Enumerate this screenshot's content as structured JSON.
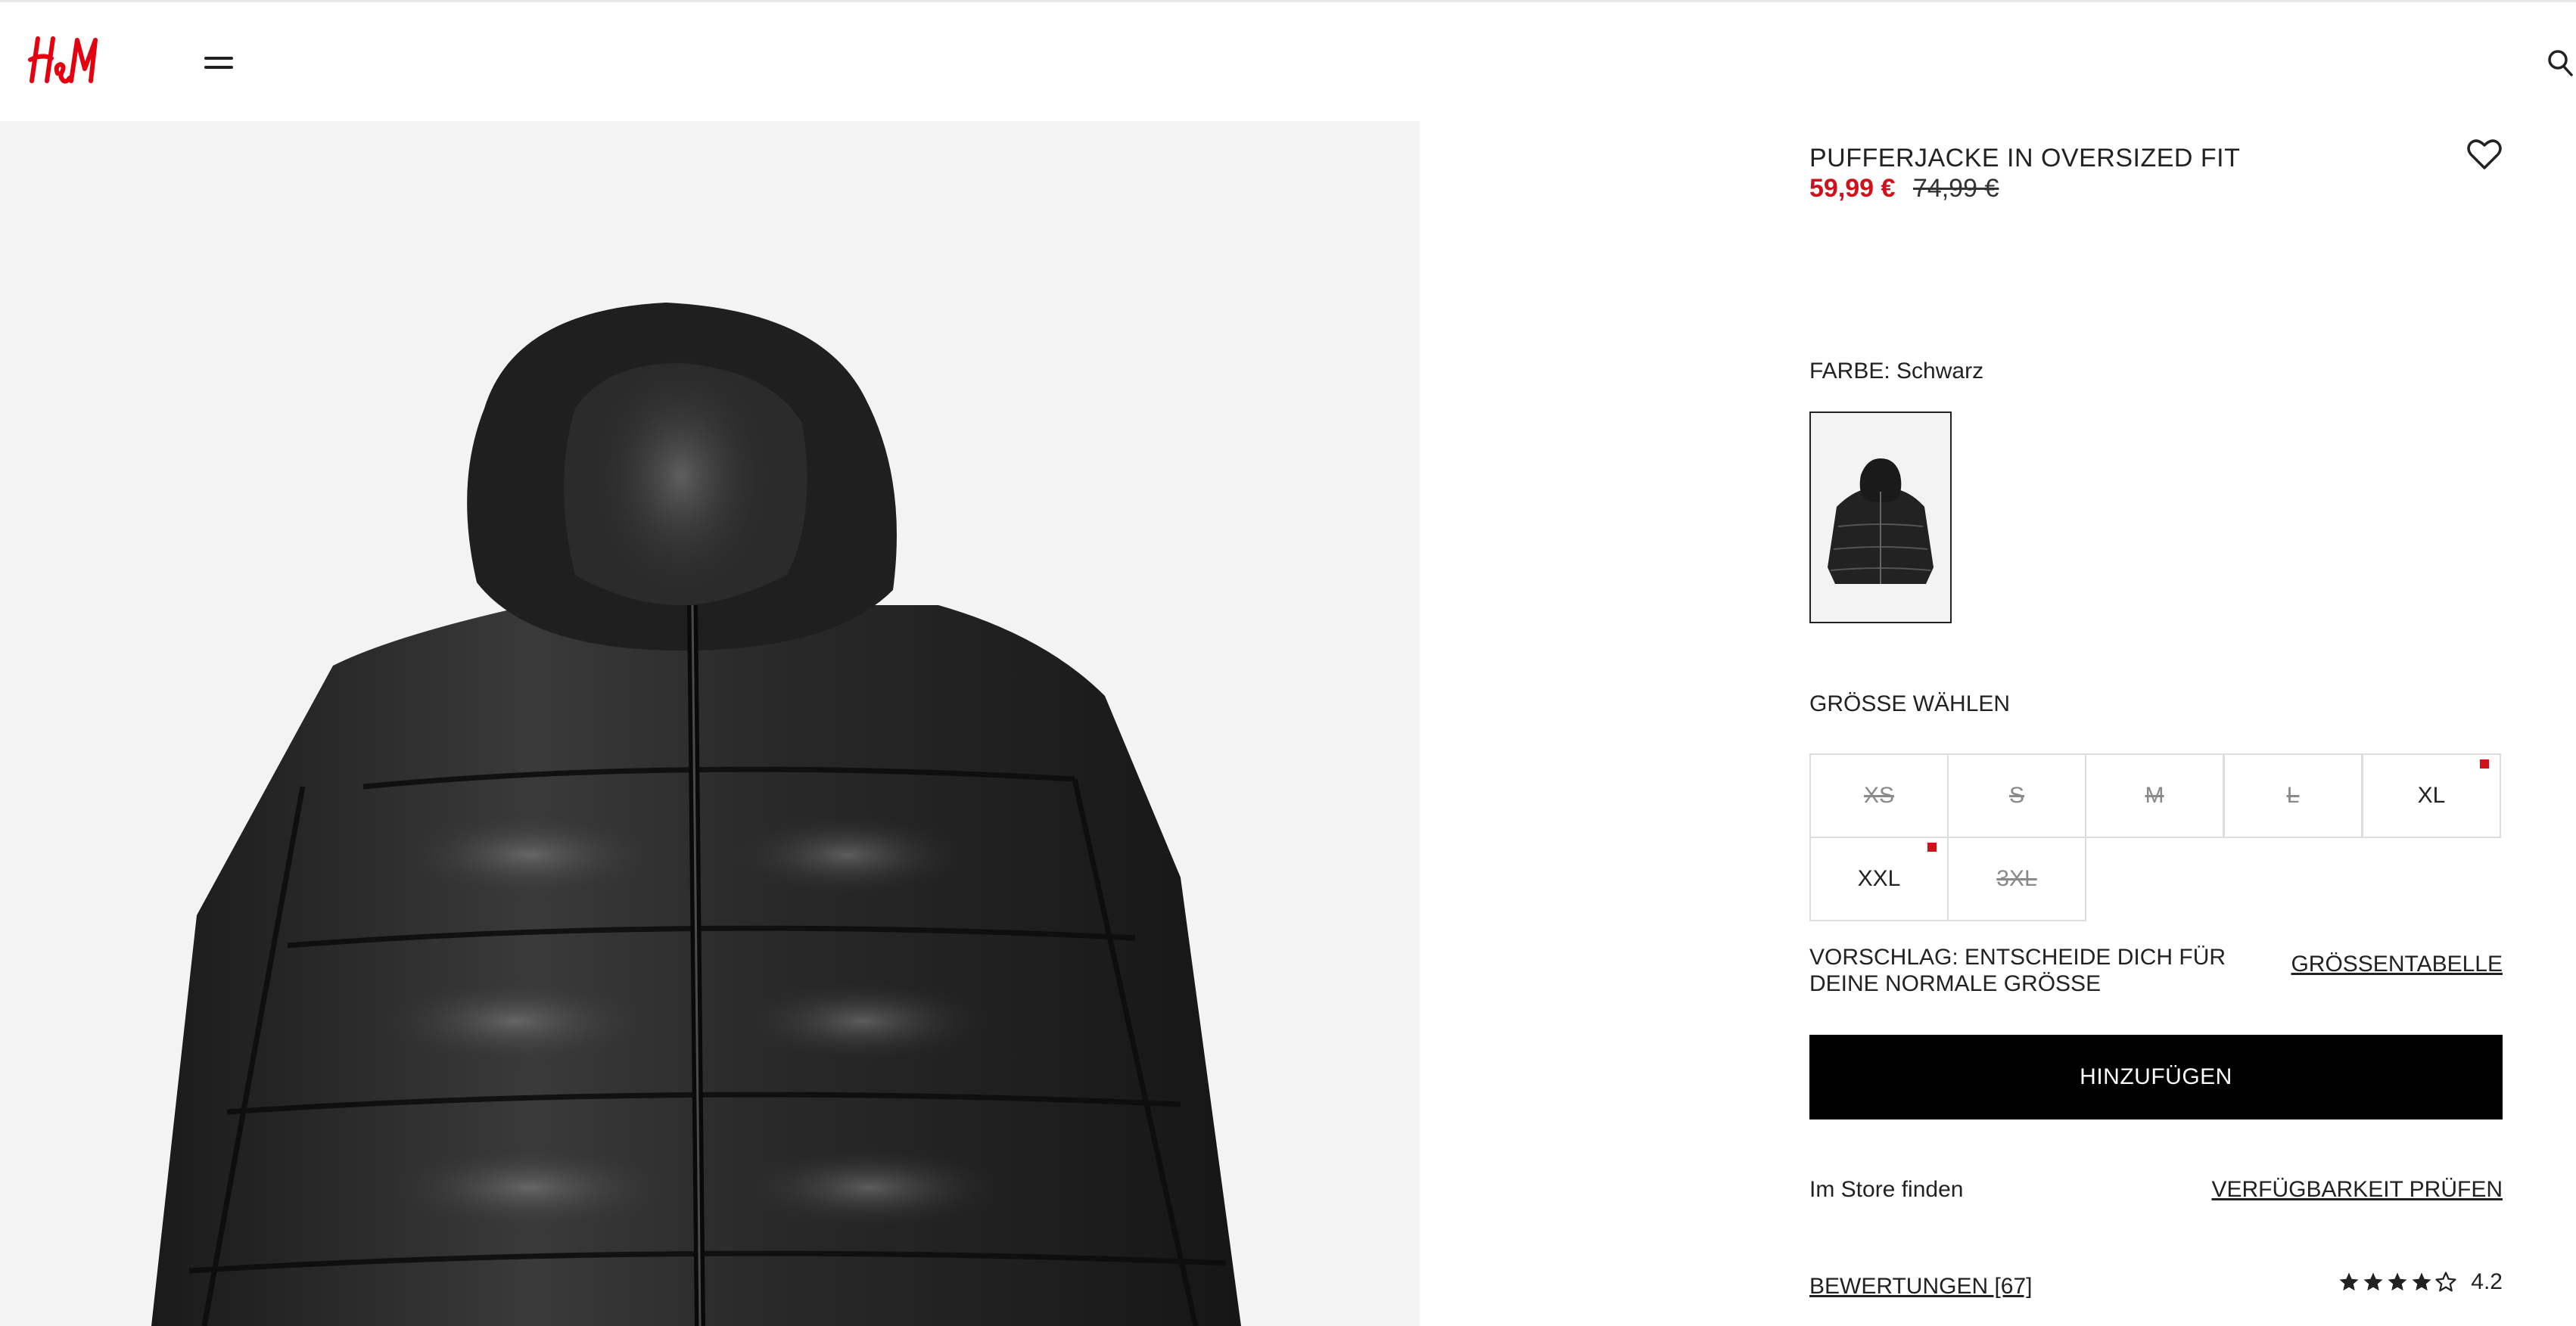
{
  "brand": {
    "logo_text": "H&M",
    "accent_color": "#d0101b"
  },
  "header": {
    "menu_icon": "hamburger-menu-icon",
    "search_icon": "search-icon"
  },
  "product": {
    "title": "PUFFERJACKE IN OVERSIZED FIT",
    "sale_price": "59,99 €",
    "original_price": "74,99 €",
    "favorite_icon": "heart-outline-icon"
  },
  "color": {
    "label": "FARBE: Schwarz",
    "swatches": [
      {
        "name": "Schwarz",
        "selected": true
      }
    ]
  },
  "size": {
    "title": "GRÖSSE WÄHLEN",
    "options": [
      {
        "label": "XS",
        "available": false,
        "low_stock": false
      },
      {
        "label": "S",
        "available": false,
        "low_stock": false
      },
      {
        "label": "M",
        "available": false,
        "low_stock": false
      },
      {
        "label": "L",
        "available": false,
        "low_stock": false
      },
      {
        "label": "XL",
        "available": true,
        "low_stock": true
      },
      {
        "label": "XXL",
        "available": true,
        "low_stock": true
      },
      {
        "label": "3XL",
        "available": false,
        "low_stock": false
      }
    ],
    "suggestion": "VORSCHLAG: ENTSCHEIDE DICH FÜR DEINE NORMALE GRÖSSE",
    "size_chart_link": "GRÖSSENTABELLE"
  },
  "actions": {
    "add_button": "HINZUFÜGEN"
  },
  "store": {
    "label": "Im Store finden",
    "availability_link": "VERFÜGBARKEIT PRÜFEN"
  },
  "reviews": {
    "link": "BEWERTUNGEN [67]",
    "rating_value": "4.2",
    "rating": 4.2,
    "max_rating": 5
  }
}
